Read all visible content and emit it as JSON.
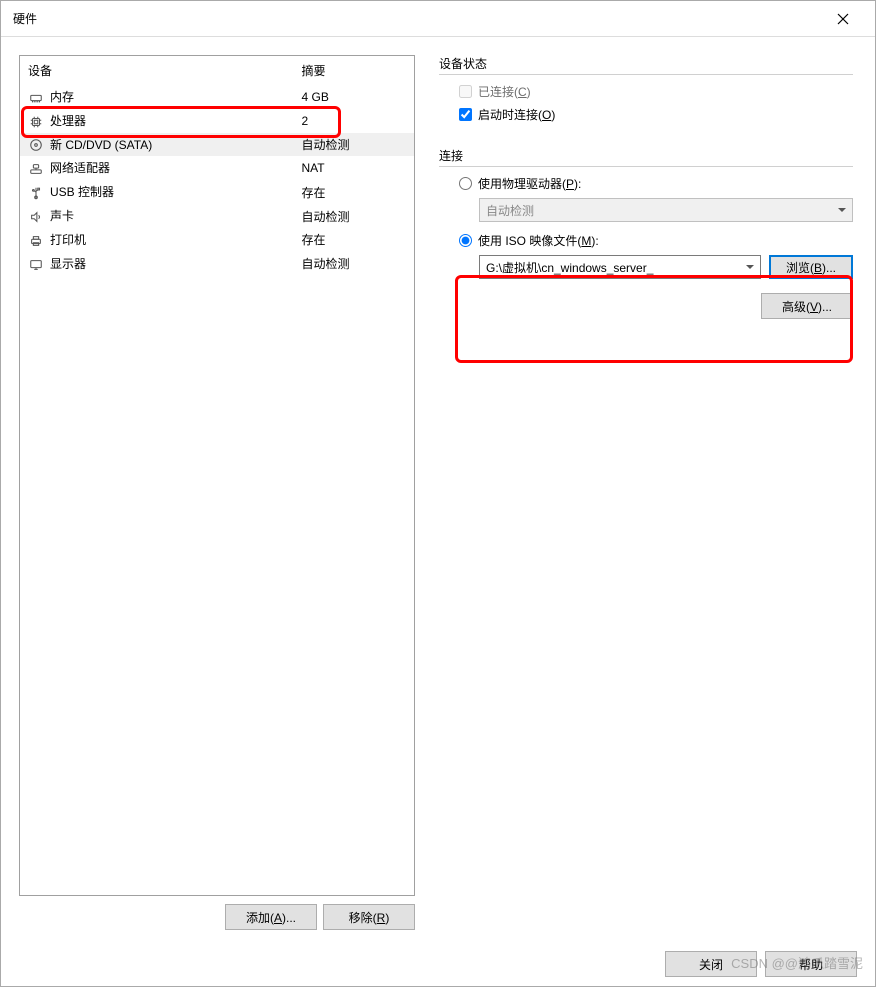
{
  "dialog": {
    "title": "硬件"
  },
  "table": {
    "headers": {
      "device": "设备",
      "summary": "摘要"
    },
    "rows": [
      {
        "icon": "memory-icon",
        "name": "内存",
        "summary": "4 GB",
        "selected": false
      },
      {
        "icon": "cpu-icon",
        "name": "处理器",
        "summary": "2",
        "selected": false
      },
      {
        "icon": "cd-icon",
        "name": "新 CD/DVD (SATA)",
        "summary": "自动检测",
        "selected": true
      },
      {
        "icon": "network-icon",
        "name": "网络适配器",
        "summary": "NAT",
        "selected": false
      },
      {
        "icon": "usb-icon",
        "name": "USB 控制器",
        "summary": "存在",
        "selected": false
      },
      {
        "icon": "sound-icon",
        "name": "声卡",
        "summary": "自动检测",
        "selected": false
      },
      {
        "icon": "printer-icon",
        "name": "打印机",
        "summary": "存在",
        "selected": false
      },
      {
        "icon": "display-icon",
        "name": "显示器",
        "summary": "自动检测",
        "selected": false
      }
    ]
  },
  "buttons": {
    "add": "添加(A)...",
    "remove": "移除(R)",
    "close": "关闭",
    "help": "帮助",
    "browse": "浏览(B)...",
    "advanced": "高级(V)..."
  },
  "status": {
    "groupTitle": "设备状态",
    "connected": "已连接(C)",
    "connectedChecked": false,
    "connectedEnabled": false,
    "connectOnPower": "启动时连接(O)",
    "connectOnPowerChecked": true
  },
  "connection": {
    "groupTitle": "连接",
    "physical": {
      "label": "使用物理驱动器(P):",
      "checked": false,
      "comboValue": "自动检测",
      "comboEnabled": false
    },
    "iso": {
      "label": "使用 ISO 映像文件(M):",
      "checked": true,
      "path": "G:\\虚拟机\\cn_windows_server_"
    }
  },
  "watermark": "CSDN @@鸿爪踏雪泥"
}
